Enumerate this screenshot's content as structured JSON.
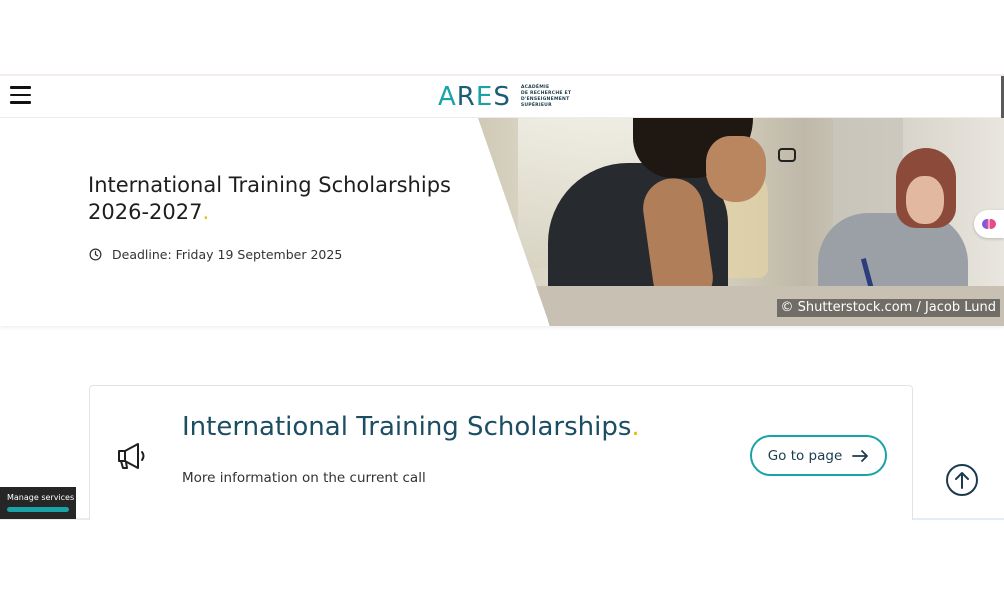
{
  "header": {
    "menu_icon": "hamburger-menu-icon",
    "logo": {
      "letters": [
        "A",
        "R",
        "E",
        "S"
      ],
      "subtitle_lines": [
        "Académie",
        "de recherche et",
        "d'enseignement",
        "supérieur"
      ]
    }
  },
  "hero": {
    "title": "International Training Scholarships 2026-2027",
    "title_dot": ".",
    "deadline_icon": "clock-icon",
    "deadline": "Deadline: Friday 19 September 2025",
    "photo_credit": "© Shutterstock.com / Jacob Lund",
    "assistant_icon": "brain-icon"
  },
  "card": {
    "icon": "megaphone-icon",
    "title": "International Training Scholarships",
    "title_dot": ".",
    "description": "More information on the current call",
    "button_label": "Go to page",
    "button_icon": "arrow-right-icon"
  },
  "floating": {
    "scroll_top_icon": "arrow-up-circle-icon",
    "manage_services_label": "Manage services"
  },
  "colors": {
    "teal": "#1aa3a6",
    "navy": "#1c4e63",
    "accent_yellow": "#e3c300"
  }
}
